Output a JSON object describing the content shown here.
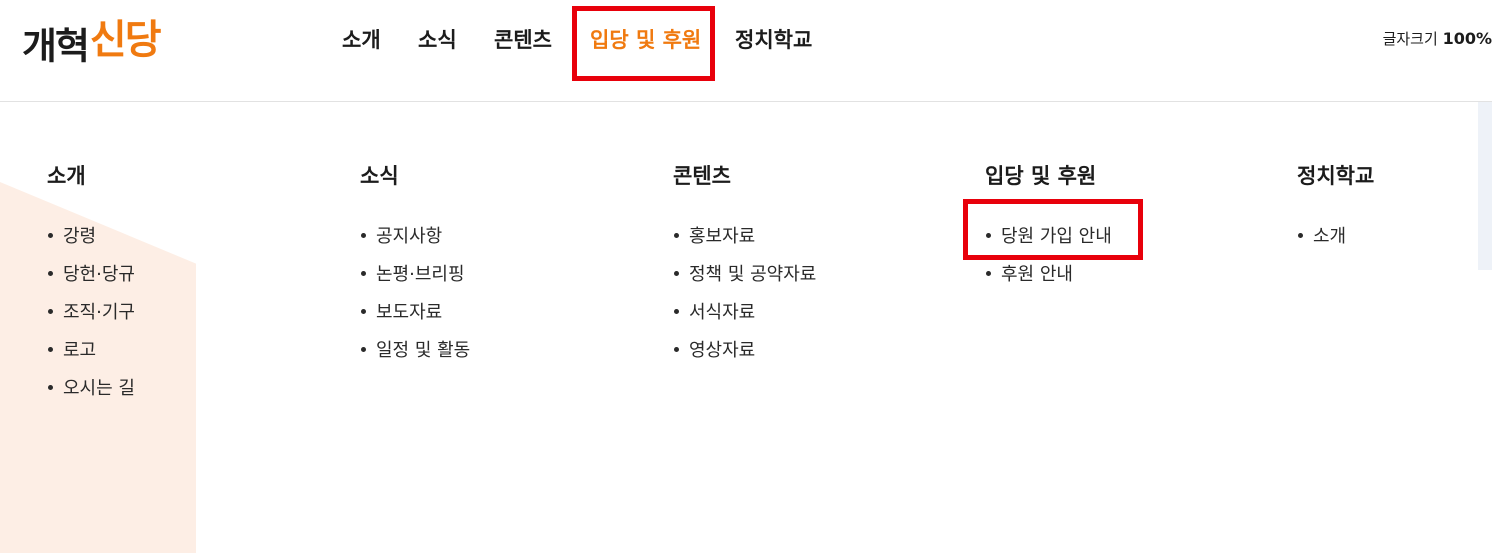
{
  "logo": {
    "part1": "개혁",
    "part2": "신당"
  },
  "nav": {
    "items": [
      {
        "label": "소개"
      },
      {
        "label": "소식"
      },
      {
        "label": "콘텐츠"
      },
      {
        "label": "입당 및 후원"
      },
      {
        "label": "정치학교"
      }
    ],
    "active_index": 3
  },
  "font_size": {
    "label": "글자크기",
    "value": "100%"
  },
  "mega_menu": {
    "columns": [
      {
        "title": "소개",
        "items": [
          "강령",
          "당헌·당규",
          "조직·기구",
          "로고",
          "오시는 길"
        ]
      },
      {
        "title": "소식",
        "items": [
          "공지사항",
          "논평·브리핑",
          "보도자료",
          "일정 및 활동"
        ]
      },
      {
        "title": "콘텐츠",
        "items": [
          "홍보자료",
          "정책 및 공약자료",
          "서식자료",
          "영상자료"
        ]
      },
      {
        "title": "입당 및 후원",
        "items": [
          "당원 가입 안내",
          "후원 안내"
        ]
      },
      {
        "title": "정치학교",
        "items": [
          "소개"
        ]
      }
    ]
  },
  "colors": {
    "accent": "#f07a10",
    "highlight": "#e8000b",
    "text": "#1c1c1c",
    "deco": "#fdeee5"
  }
}
